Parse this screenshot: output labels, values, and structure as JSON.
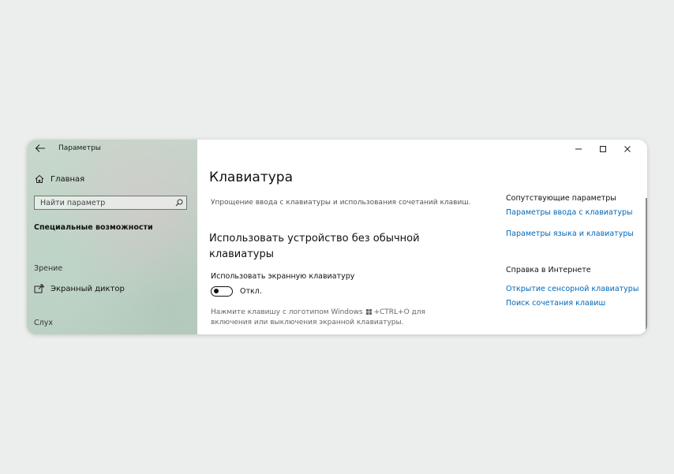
{
  "window": {
    "app_title": "Параметры",
    "controls": {
      "minimize": "minimize-icon",
      "maximize": "maximize-icon",
      "close": "close-icon"
    }
  },
  "sidebar": {
    "home_label": "Главная",
    "search_placeholder": "Найти параметр",
    "section_heading": "Специальные возможности",
    "groups": [
      {
        "label": "Зрение",
        "items": [
          {
            "label": "Экранный диктор",
            "icon": "narrator-icon"
          }
        ]
      },
      {
        "label": "Слух",
        "items": []
      }
    ]
  },
  "main": {
    "title": "Клавиатура",
    "subtitle": "Упрощение ввода с клавиатуры и использования сочетаний клавиш.",
    "section_title": "Использовать устройство без обычной клавиатуры",
    "toggle_label": "Использовать экранную клавиатуру",
    "toggle_state_text": "Откл.",
    "toggle_on": false,
    "hint_part1": "Нажмите клавишу с логотипом Windows",
    "hint_part2": "+CTRL+O для включения или выключения экранной клавиатуры."
  },
  "related": {
    "heading": "Сопутствующие параметры",
    "links": [
      "Параметры ввода с клавиатуры",
      "Параметры языка и клавиатуры"
    ],
    "help_heading": "Справка в Интернете",
    "help_links": [
      "Открытие сенсорной клавиатуры",
      "Поиск сочетания клавиш"
    ]
  },
  "colors": {
    "accent_link": "#0067b8",
    "sidebar_tint": "#c3d4c8"
  }
}
